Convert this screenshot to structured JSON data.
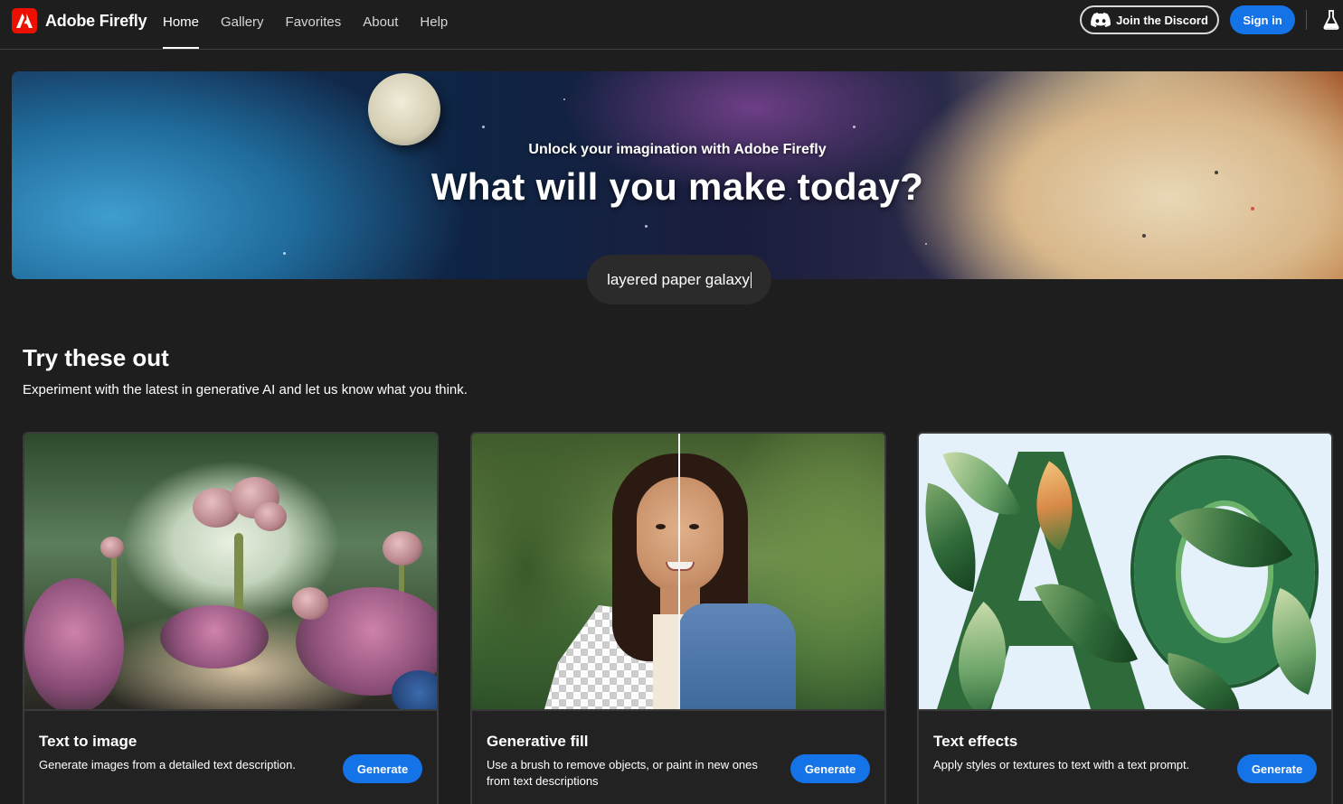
{
  "app": {
    "name": "Adobe Firefly",
    "logo_icon": "adobe-logo-icon"
  },
  "nav": {
    "items": [
      {
        "label": "Home",
        "active": true
      },
      {
        "label": "Gallery",
        "active": false
      },
      {
        "label": "Favorites",
        "active": false
      },
      {
        "label": "About",
        "active": false
      },
      {
        "label": "Help",
        "active": false
      }
    ]
  },
  "header_actions": {
    "discord_label": "Join the Discord",
    "discord_icon": "discord-icon",
    "signin_label": "Sign in",
    "labs_icon": "beaker-icon"
  },
  "hero": {
    "subtitle": "Unlock your imagination with Adobe Firefly",
    "title": "What will you make today?",
    "prompt_value": "layered paper galaxy"
  },
  "section": {
    "title": "Try these out",
    "subtitle": "Experiment with the latest in generative AI and let us know what you think."
  },
  "cards": [
    {
      "title": "Text to image",
      "description": "Generate images from a detailed text description.",
      "button": "Generate"
    },
    {
      "title": "Generative fill",
      "description": "Use a brush to remove objects, or paint in new ones from text descriptions",
      "button": "Generate"
    },
    {
      "title": "Text effects",
      "description": "Apply styles or textures to text with a text prompt.",
      "button": "Generate"
    }
  ],
  "colors": {
    "background": "#1e1e1e",
    "accent_blue": "#1473e6",
    "brand_red": "#eb1000",
    "card_border": "#3a3a3a"
  }
}
